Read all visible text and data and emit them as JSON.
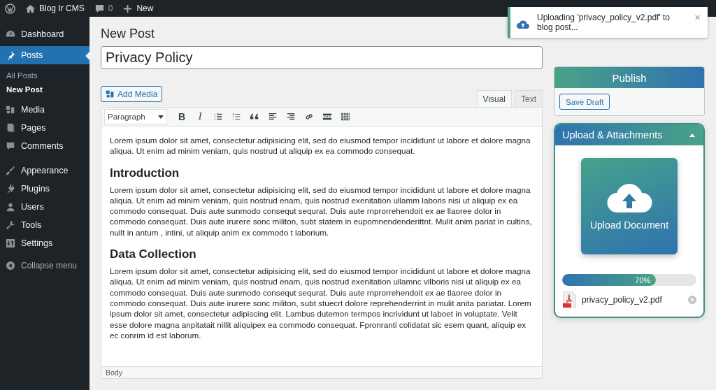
{
  "top_bar": {
    "site": "Blog Ir CMS",
    "comments": "0",
    "new": "New"
  },
  "sidebar": {
    "items": [
      {
        "label": "Dashboard",
        "kind": "dashboard",
        "selected": false
      },
      {
        "label": "Posts",
        "kind": "pin",
        "selected": true,
        "children": [
          {
            "label": "All Posts",
            "selected": false
          },
          {
            "label": "New Post",
            "selected": true
          }
        ]
      },
      {
        "label": "Media",
        "kind": "media",
        "selected": false
      },
      {
        "label": "Pages",
        "kind": "pages",
        "selected": false
      },
      {
        "label": "Comments",
        "kind": "comment",
        "selected": false
      },
      {
        "label": "Appearance",
        "kind": "brush",
        "selected": false
      },
      {
        "label": "Plugins",
        "kind": "plug",
        "selected": false
      },
      {
        "label": "Users",
        "kind": "user",
        "selected": false
      },
      {
        "label": "Tools",
        "kind": "wrench",
        "selected": false
      },
      {
        "label": "Settings",
        "kind": "settings",
        "selected": false
      }
    ],
    "collapse": "Collapse menu"
  },
  "page_title": "New Post",
  "post_title": "Privacy Policy",
  "add_media": "Add Media",
  "editor_tabs": [
    {
      "label": "Visual",
      "selected": true
    },
    {
      "label": "Text",
      "selected": false
    }
  ],
  "toolbar": {
    "format": "Paragraph",
    "buttons": [
      {
        "kind": "bold",
        "label": "B"
      },
      {
        "kind": "italic",
        "label": "I"
      },
      {
        "kind": "bullets"
      },
      {
        "kind": "numbers"
      },
      {
        "kind": "quote"
      },
      {
        "kind": "align-left"
      },
      {
        "kind": "align-right"
      },
      {
        "kind": "link"
      },
      {
        "kind": "more"
      },
      {
        "kind": "toolbar"
      }
    ]
  },
  "content": [
    {
      "kind": "paragraph",
      "text": "Lorem ipsum dolor sit amet, consectetur adipisicing elit, sed do eiusmod tempor incididunt ut labore et dolore magna aliqua. Ut enim ad minim veniam, quis nostrud ut aliquip ex ea commodo consequat."
    },
    {
      "kind": "heading",
      "text": "Introduction"
    },
    {
      "kind": "paragraph",
      "text": "Lorem ipsum dolor sit amet, consectetur adipisicing elit, sed do eiusmod tempor incididunt ut labore et dolore magna aliqua. Ut enim ad minim veniam, quis nostrud enam, quis nostrud exenitation ullamm laboris nisi ut aliquip ex ea commodo consequat. Duis aute sunmodo consequt sequrat. Duis aute rnprorrehendoit ex ae llaoree dolor in commodo consequat. Duis aute irurere sonc militon, subt statem in eupomnendenderittnt. Mulit anim pariat in cultins, nullt in antum , intini, ut aliquip anim ex commodo t laborium."
    },
    {
      "kind": "heading",
      "text": "Data Collection"
    },
    {
      "kind": "paragraph",
      "text": "Lorem ipsum dolor sit amet, consectetur adipisicing elit, sed do eiusmod tempor incididunt ut labore et dolore magna aliqua. Ut enim ad minim veniam, quis nostrud enam, quis nostrud exenitation ullamnc vilboris nisi ut aliquip ex ea commodo consequat. Duis aute sunmodo consequt sequrat. Duis aute rnprorrehendoit ex ae tlaoree dolor in commodo consequat. Duis aute irurere sonc militon, subt stuecrt dolore reprehenderrint in mulit anita pariatar. Lorem ipsum dolor sit amet, consectetur adipiscing elit. Lambus dutemon termpos incrividunt ut laboet in voluptate. Velit esse dolore magna anpitatait nillit aliquipex ea commodo consequat. Fpronranti colidatat sic esem quant, aliquip ex ec conrim id est laborum."
    }
  ],
  "status_path": "Body",
  "publish": {
    "title": "Publish",
    "save_draft": "Save Draft"
  },
  "upload_panel": {
    "title": "Upload & Attachments",
    "expanded": true,
    "button": "Upload Document",
    "progress": {
      "level": 0.7,
      "label": "70%"
    },
    "file": "privacy_policy_v2.pdf"
  },
  "notice": {
    "text": "Uploading 'privacy_policy_v2.pdf' to blog post...",
    "close": "×"
  }
}
